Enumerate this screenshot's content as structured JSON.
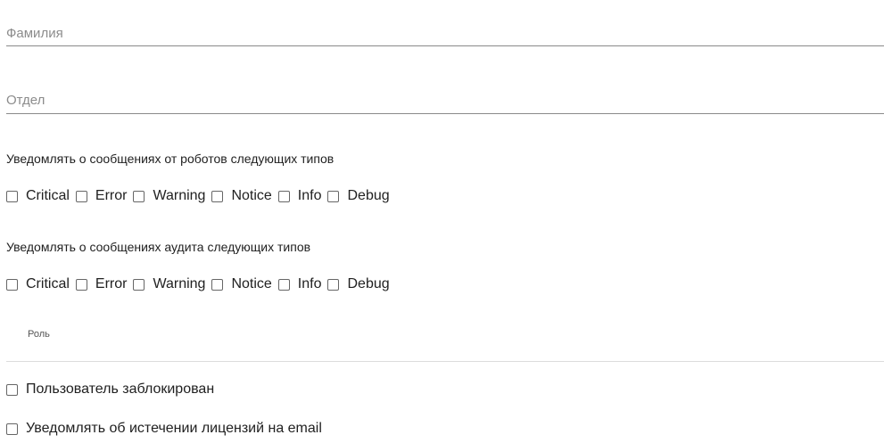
{
  "fields": {
    "last_name_placeholder": "Фамилия",
    "department_placeholder": "Отдел"
  },
  "robot_notifications": {
    "label": "Уведомлять о сообщениях от роботов следующих типов",
    "options": [
      "Critical",
      "Error",
      "Warning",
      "Notice",
      "Info",
      "Debug"
    ]
  },
  "audit_notifications": {
    "label": "Уведомлять о сообщениях аудита следующих типов",
    "options": [
      "Critical",
      "Error",
      "Warning",
      "Notice",
      "Info",
      "Debug"
    ]
  },
  "role": {
    "label": "Роль"
  },
  "user_blocked": {
    "label": "Пользователь заблокирован"
  },
  "license_email": {
    "label": "Уведомлять об истечении лицензий на email"
  }
}
